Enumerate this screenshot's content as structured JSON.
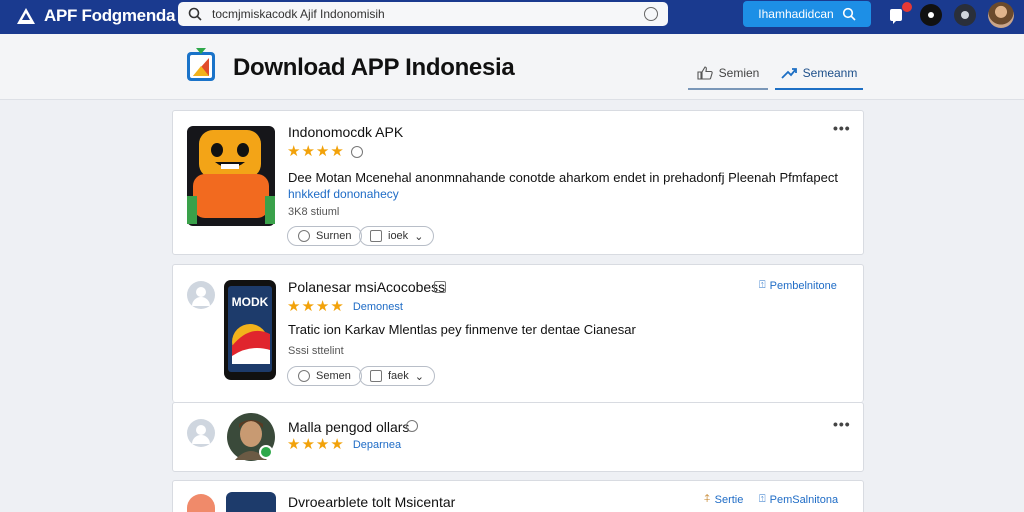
{
  "topbar": {
    "brand": "APF Fodgmenda",
    "search_value": "tocmjmiskacodk Ajif Indonomisih",
    "action_button": "Ihamhadidcan",
    "notification_count": ""
  },
  "header": {
    "title": "Download APP Indonesia",
    "tabs": [
      "Semien",
      "Semeanm"
    ]
  },
  "apps": [
    {
      "name": "Indonomocdk APK",
      "rating": 4,
      "description": "Dee Motan Mcenehal anonmnahande conotde aharkom endet in prehadonfj Pleenah Pfmfapect",
      "description2": "hnkkedf dononahecy",
      "meta": "3K8 stiuml",
      "actions": [
        "Surnen",
        "ioek"
      ]
    },
    {
      "name": "Polanesar msiAcocobess",
      "rating": 4,
      "rating_label": "Demonest",
      "description": "Tratic ion Karkav Mlentlas pey finmenve ter dentae Cianesar",
      "meta": "Sssi sttelint",
      "actions": [
        "Semen",
        "faek"
      ],
      "link": "Pembelnitone"
    },
    {
      "name": "Malla pengod ollars",
      "rating": 4,
      "rating_label": "Deparnea"
    },
    {
      "name": "Dvroearblete tolt Msicentar",
      "link_left": "Sertie",
      "link": "PemSalnitona"
    }
  ],
  "colors": {
    "topbar": "#1a3a8f",
    "accent": "#1d8fe6",
    "star": "#f2a20a",
    "link": "#1f6cc6"
  }
}
